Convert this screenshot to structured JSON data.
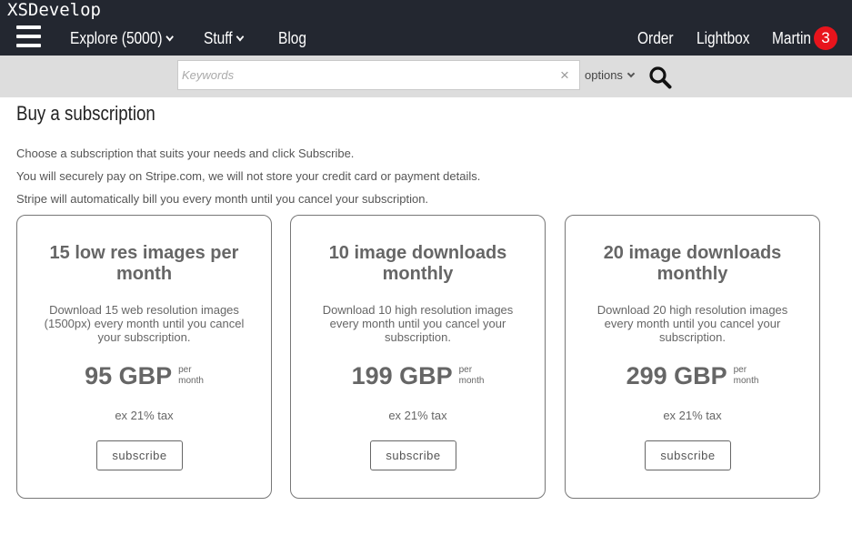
{
  "header": {
    "site_title": "XSDevelop",
    "nav": {
      "explore": "Explore (5000)",
      "stuff": "Stuff",
      "blog": "Blog",
      "order": "Order",
      "lightbox": "Lightbox",
      "user": "Martin",
      "notification_count": "3"
    }
  },
  "search": {
    "placeholder": "Keywords",
    "value": "",
    "clear_label": "×",
    "options_label": "options"
  },
  "main": {
    "title": "Buy a subscription",
    "intro": [
      "Choose a subscription that suits your needs and click Subscribe.",
      "You will securely pay on Stripe.com, we will not store your credit card or payment details.",
      "Stripe will automatically bill you every month until you cancel your subscription."
    ],
    "plans": [
      {
        "title": "15 low res images per month",
        "description": "Download 15 web resolution images (1500px) every month until you cancel your subscription.",
        "price": "95 GBP",
        "unit_top": "per",
        "unit_bottom": "month",
        "tax": "ex 21% tax",
        "button": "subscribe"
      },
      {
        "title": "10 image downloads monthly",
        "description": "Download 10 high resolution images every month until you cancel your subscription.",
        "price": "199 GBP",
        "unit_top": "per",
        "unit_bottom": "month",
        "tax": "ex 21% tax",
        "button": "subscribe"
      },
      {
        "title": "20 image downloads monthly",
        "description": "Download 20 high resolution images every month until you cancel your subscription.",
        "price": "299 GBP",
        "unit_top": "per",
        "unit_bottom": "month",
        "tax": "ex 21% tax",
        "button": "subscribe"
      }
    ]
  },
  "colors": {
    "header_bg": "#232730",
    "searchbar_bg": "#dddddd",
    "badge": "#e8141c"
  },
  "icons": {
    "menu": "hamburger-icon",
    "search": "search-icon",
    "clear": "close-icon",
    "dropdown": "chevron-down-icon"
  }
}
